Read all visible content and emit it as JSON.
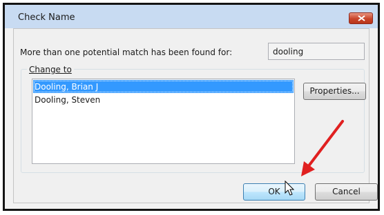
{
  "dialog": {
    "title": "Check Name",
    "close_icon": "close-icon",
    "match_label": "More than one potential match has been found for:",
    "search_value": "dooling",
    "group_label": "Change to",
    "items": [
      {
        "label": "Dooling, Brian J",
        "selected": true
      },
      {
        "label": "Dooling, Steven",
        "selected": false
      }
    ],
    "properties_label": "Properties...",
    "ok_label": "OK",
    "cancel_label": "Cancel"
  },
  "colors": {
    "title_bar": "#c8dbf2",
    "selection": "#3399ff",
    "close_button": "#c9452b",
    "annotation_arrow": "#e02020"
  },
  "annotation": {
    "type": "red-arrow",
    "points_to": "ok-button",
    "icon": "mouse-cursor-icon"
  }
}
